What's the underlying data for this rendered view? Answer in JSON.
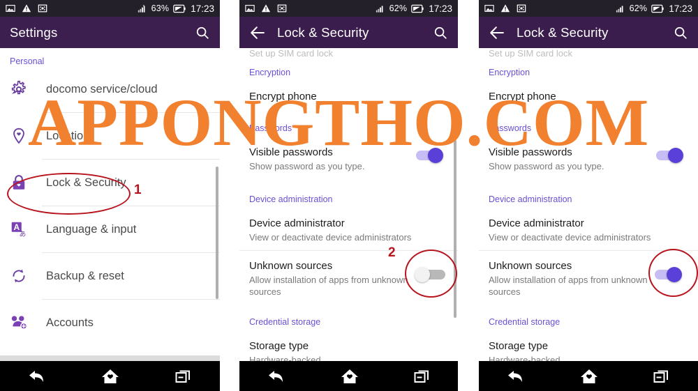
{
  "watermark": {
    "text": "APPONGTHO.COM",
    "color": "#f2812f"
  },
  "annotations": {
    "color": "#b8141e",
    "marker_1": "1",
    "marker_2": "2"
  },
  "statusbar": {
    "icons": [
      "image-icon",
      "warning-icon",
      "screenshot-icon",
      "signal-icon"
    ],
    "battery_1": "63%",
    "battery_2": "62%",
    "battery_3": "62%",
    "time": "17:23"
  },
  "navbar": {
    "back_label": "back-icon",
    "home_label": "home-icon",
    "recents_label": "recent-apps-icon"
  },
  "panel1": {
    "appbar": {
      "title": "Settings",
      "search": "search-icon"
    },
    "section": "Personal",
    "items": [
      {
        "label": "docomo service/cloud",
        "icon": "gear-icon"
      },
      {
        "label": "Location",
        "icon": "location-pin-icon"
      },
      {
        "label": "Lock & Security",
        "icon": "lock-icon"
      },
      {
        "label": "Language & input",
        "icon": "language-icon"
      },
      {
        "label": "Backup & reset",
        "icon": "sync-icon"
      },
      {
        "label": "Accounts",
        "icon": "accounts-icon"
      }
    ]
  },
  "panel2": {
    "appbar": {
      "title": "Lock & Security",
      "back": "back-arrow-icon",
      "search": "search-icon"
    },
    "cut_row": "Set up SIM card lock",
    "sections": [
      {
        "header": "Encryption",
        "rows": [
          {
            "title": "Encrypt phone",
            "subtitle": ""
          }
        ]
      },
      {
        "header": "Passwords",
        "rows": [
          {
            "title": "Visible passwords",
            "subtitle": "Show password as you type.",
            "toggle": "on"
          }
        ]
      },
      {
        "header": "Device administration",
        "rows": [
          {
            "title": "Device administrator",
            "subtitle": "View or deactivate device administrators"
          },
          {
            "title": "Unknown sources",
            "subtitle": "Allow installation of apps from unknown sources",
            "toggle": "off"
          }
        ]
      },
      {
        "header": "Credential storage",
        "rows": [
          {
            "title": "Storage type",
            "subtitle": "Hardware-backed"
          }
        ]
      }
    ]
  },
  "panel3": {
    "appbar": {
      "title": "Lock & Security",
      "back": "back-arrow-icon",
      "search": "search-icon"
    },
    "cut_row": "Set up SIM card lock",
    "sections": [
      {
        "header": "Encryption",
        "rows": [
          {
            "title": "Encrypt phone",
            "subtitle": ""
          }
        ]
      },
      {
        "header": "Passwords",
        "rows": [
          {
            "title": "Visible passwords",
            "subtitle": "Show password as you type.",
            "toggle": "on"
          }
        ]
      },
      {
        "header": "Device administration",
        "rows": [
          {
            "title": "Device administrator",
            "subtitle": "View or deactivate device administrators"
          },
          {
            "title": "Unknown sources",
            "subtitle": "Allow installation of apps from unknown sources",
            "toggle": "on"
          }
        ]
      },
      {
        "header": "Credential storage",
        "rows": [
          {
            "title": "Storage type",
            "subtitle": "Hardware-backed"
          }
        ]
      }
    ]
  }
}
